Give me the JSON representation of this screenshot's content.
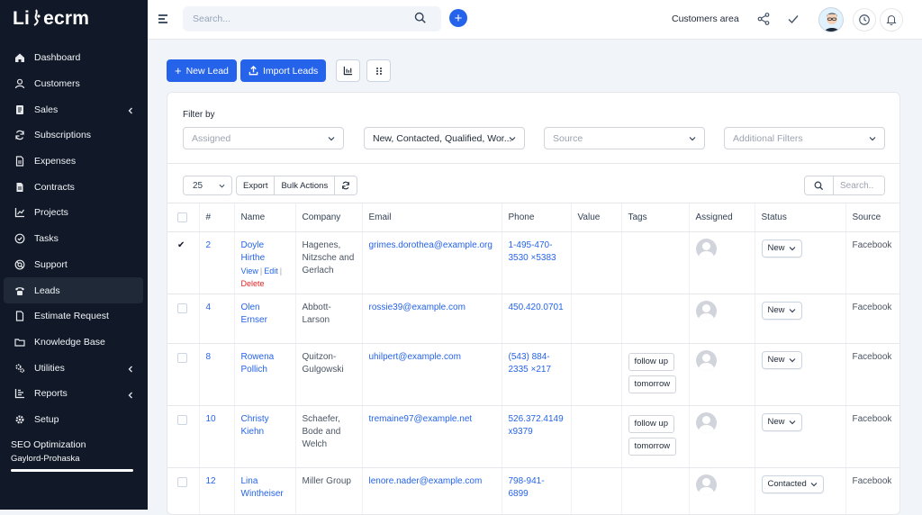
{
  "app": {
    "logo": "Li ecrm"
  },
  "sidebar": {
    "items": [
      {
        "label": "Dashboard",
        "icon": "home-icon"
      },
      {
        "label": "Customers",
        "icon": "user-icon"
      },
      {
        "label": "Sales",
        "icon": "receipt-icon",
        "expandable": true
      },
      {
        "label": "Subscriptions",
        "icon": "refresh-icon"
      },
      {
        "label": "Expenses",
        "icon": "file-icon"
      },
      {
        "label": "Contracts",
        "icon": "contract-icon"
      },
      {
        "label": "Projects",
        "icon": "chart-icon"
      },
      {
        "label": "Tasks",
        "icon": "check-circle-icon"
      },
      {
        "label": "Support",
        "icon": "lifebuoy-icon"
      },
      {
        "label": "Leads",
        "icon": "phone-icon",
        "active": true
      },
      {
        "label": "Estimate Request",
        "icon": "document-icon"
      },
      {
        "label": "Knowledge Base",
        "icon": "folder-icon"
      },
      {
        "label": "Utilities",
        "icon": "cogs-icon",
        "expandable": true
      },
      {
        "label": "Reports",
        "icon": "bar-chart-icon",
        "expandable": true
      },
      {
        "label": "Setup",
        "icon": "gear-icon"
      }
    ],
    "footer": {
      "title": "SEO Optimization",
      "subtitle": "Gaylord-Prohaska",
      "progress": 1.0
    }
  },
  "topbar": {
    "search_placeholder": "Search...",
    "customers_area": "Customers area"
  },
  "toolbar": {
    "new_lead": "New Lead",
    "import_leads": "Import Leads"
  },
  "filters": {
    "label": "Filter by",
    "assigned_placeholder": "Assigned",
    "status_value": "New, Contacted, Qualified, Wor...",
    "source_placeholder": "Source",
    "additional_placeholder": "Additional Filters"
  },
  "table_controls": {
    "page_size": "25",
    "export": "Export",
    "bulk_actions": "Bulk Actions",
    "search_placeholder": "Search.."
  },
  "table": {
    "columns": [
      "#",
      "Name",
      "Company",
      "Email",
      "Phone",
      "Value",
      "Tags",
      "Assigned",
      "Status",
      "Source"
    ],
    "row_actions": {
      "view": "View",
      "edit": "Edit",
      "delete": "Delete"
    },
    "rows": [
      {
        "id": "2",
        "name": "Doyle Hirthe",
        "company": "Hagenes, Nitzsche and Gerlach",
        "email": "grimes.dorothea@example.org",
        "phone": "1-495-470-3530 ×5383",
        "value": "",
        "tags": [],
        "status": "New",
        "source": "Facebook",
        "checked": true
      },
      {
        "id": "4",
        "name": "Olen Ernser",
        "company": "Abbott-Larson",
        "email": "rossie39@example.com",
        "phone": "450.420.0701",
        "value": "",
        "tags": [],
        "status": "New",
        "source": "Facebook",
        "checked": false
      },
      {
        "id": "8",
        "name": "Rowena Pollich",
        "company": "Quitzon-Gulgowski",
        "email": "uhilpert@example.com",
        "phone": "(543) 884-2335 ×217",
        "value": "",
        "tags": [
          "follow up",
          "tomorrow"
        ],
        "status": "New",
        "source": "Facebook",
        "checked": false
      },
      {
        "id": "10",
        "name": "Christy Kiehn",
        "company": "Schaefer, Bode and Welch",
        "email": "tremaine97@example.net",
        "phone": "526.372.4149 x9379",
        "value": "",
        "tags": [
          "follow up",
          "tomorrow"
        ],
        "status": "New",
        "source": "Facebook",
        "checked": false
      },
      {
        "id": "12",
        "name": "Lina Wintheiser",
        "company": "Miller Group",
        "email": "lenore.nader@example.com",
        "phone": "798-941-6899",
        "value": "",
        "tags": [],
        "status": "Contacted",
        "source": "Facebook",
        "checked": false
      }
    ]
  },
  "colors": {
    "primary": "#2563eb",
    "sidebar_bg": "#111827",
    "danger": "#dc2626"
  }
}
